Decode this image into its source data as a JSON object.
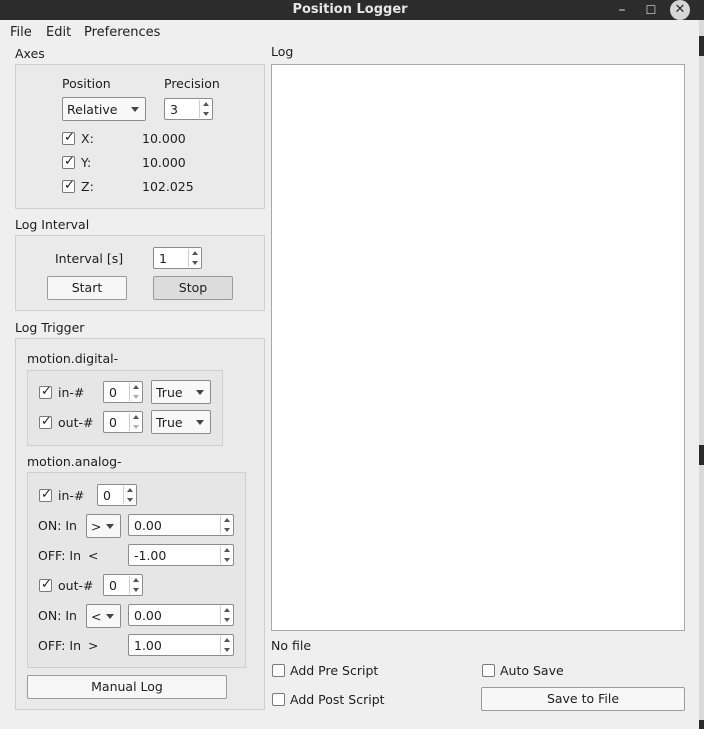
{
  "window": {
    "title": "Position Logger"
  },
  "menu": [
    "File",
    "Edit",
    "Preferences"
  ],
  "axes": {
    "group": "Axes",
    "position_label": "Position",
    "precision_label": "Precision",
    "position_value": "Relative",
    "precision_value": "3",
    "rows": [
      {
        "label": "X:",
        "checked": true,
        "value": "10.000"
      },
      {
        "label": "Y:",
        "checked": true,
        "value": "10.000"
      },
      {
        "label": "Z:",
        "checked": true,
        "value": "102.025"
      }
    ]
  },
  "interval": {
    "group": "Log Interval",
    "label": "Interval [s]",
    "value": "1",
    "start": "Start",
    "stop": "Stop"
  },
  "trigger": {
    "group": "Log Trigger",
    "digital": {
      "title": "motion.digital-",
      "in_label": "in-#",
      "in_index": "0",
      "in_state": "True",
      "out_label": "out-#",
      "out_index": "0",
      "out_state": "True"
    },
    "analog": {
      "title": "motion.analog-",
      "in_label": "in-#",
      "in_index": "0",
      "in_on_label": "ON:  In",
      "in_on_op": ">",
      "in_on_value": "0.00",
      "in_off_label": "OFF: In",
      "in_off_op": "<",
      "in_off_value": "-1.00",
      "out_label": "out-#",
      "out_index": "0",
      "out_on_label": "ON:  In",
      "out_on_op": "<",
      "out_on_value": "0.00",
      "out_off_label": "OFF: In",
      "out_off_op": ">",
      "out_off_value": "1.00"
    },
    "manual": "Manual Log"
  },
  "log": {
    "group": "Log",
    "file_status": "No file",
    "pre_script": "Add Pre Script",
    "post_script": "Add Post Script",
    "auto_save": "Auto Save",
    "save": "Save to File"
  }
}
